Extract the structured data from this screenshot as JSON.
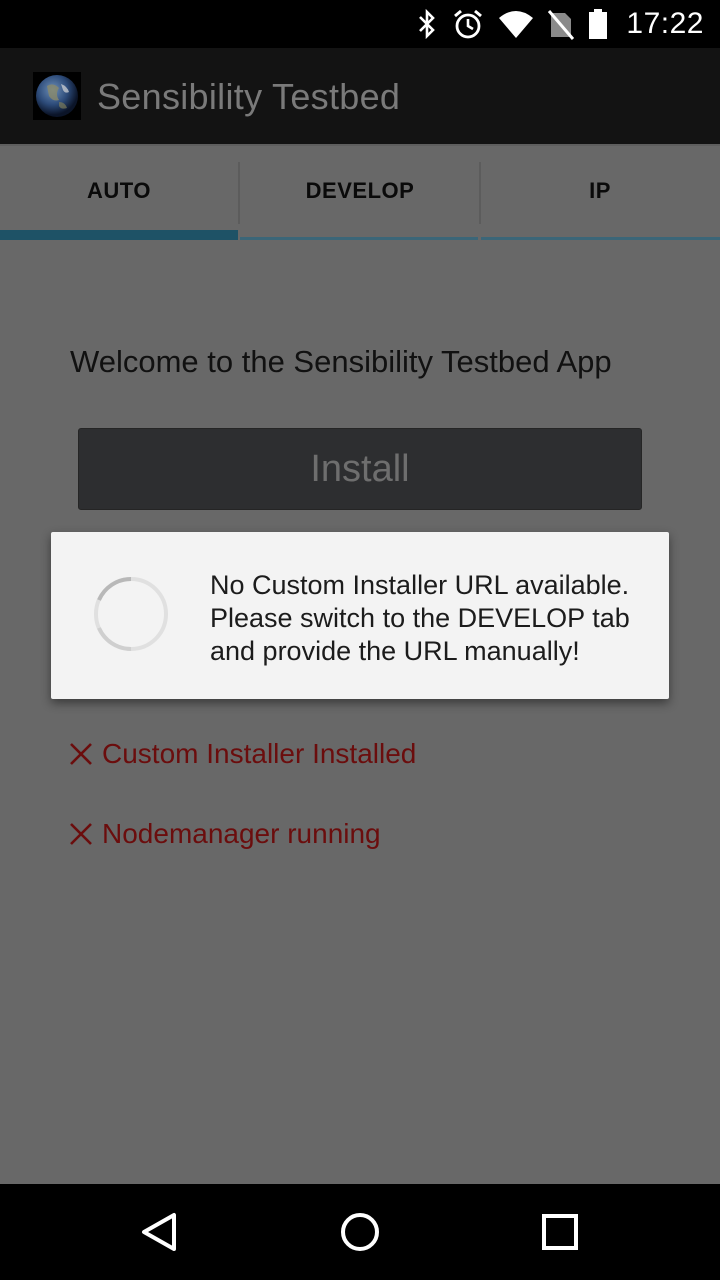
{
  "status_bar": {
    "time": "17:22",
    "icons": [
      "bluetooth-icon",
      "alarm-icon",
      "wifi-icon",
      "no-sim-icon",
      "battery-icon"
    ]
  },
  "action_bar": {
    "title": "Sensibility Testbed",
    "logo": "earth-logo"
  },
  "tabs": [
    {
      "label": "AUTO",
      "selected": true
    },
    {
      "label": "DEVELOP",
      "selected": false
    },
    {
      "label": "IP",
      "selected": false
    }
  ],
  "main": {
    "welcome_text": "Welcome to the Sensibility Testbed App",
    "install_label": "Install",
    "checks": [
      {
        "label": "Custom Installer Installed",
        "status": "failed",
        "icon": "x-icon"
      },
      {
        "label": "Nodemanager running",
        "status": "failed",
        "icon": "x-icon"
      }
    ]
  },
  "dialog": {
    "message": "No Custom Installer URL available.\nPlease switch to the DEVELOP tab\nand provide the URL manually!",
    "spinner": "progress-spinner-icon"
  },
  "nav_bar": {
    "buttons": [
      "back-icon",
      "home-icon",
      "recents-icon"
    ]
  },
  "colors": {
    "tab_indicator": "#1e5266",
    "error_text": "#6b0d0d",
    "dim_background": "#686868"
  }
}
